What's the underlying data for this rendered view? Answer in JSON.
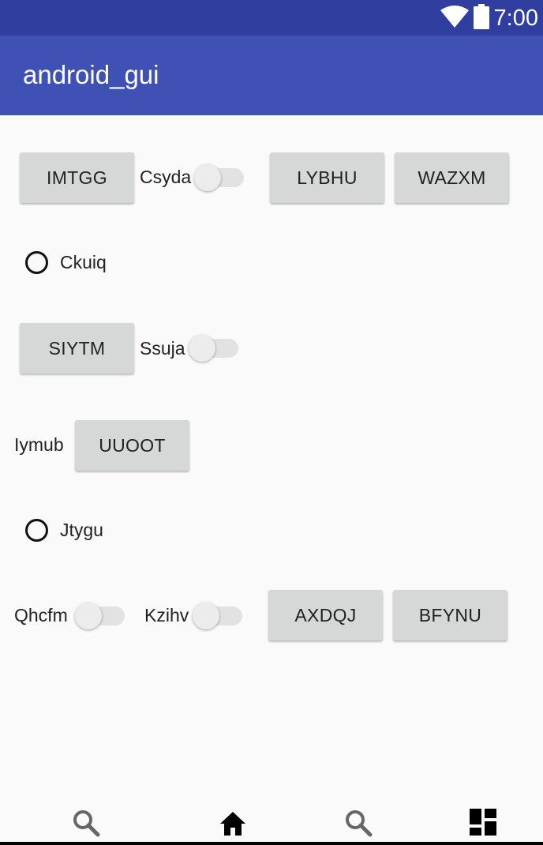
{
  "status_bar": {
    "time": "7:00",
    "icons": [
      "wifi-icon",
      "battery-icon"
    ]
  },
  "app_bar": {
    "title": "android_gui"
  },
  "controls": {
    "imtgg": "IMTGG",
    "csyda": "Csyda",
    "lybhu": "LYBHU",
    "wazxm": "WAZXM",
    "ckuiq": "Ckuiq",
    "siytm": "SIYTM",
    "ssuja": "Ssuja",
    "iymub": "Iymub",
    "uuoot": "UUOOT",
    "jtygu": "Jtygu",
    "qhcfm": "Qhcfm",
    "kzihv": "Kzihv",
    "axdqj": "AXDQJ",
    "bfynu": "BFYNU"
  },
  "switch_states": {
    "csyda": false,
    "ssuja": false,
    "qhcfm": false,
    "kzihv": false
  },
  "radio_states": {
    "ckuiq": false,
    "jtygu": false
  },
  "bottom_nav": [
    "search-icon",
    "home-icon",
    "search-icon",
    "dashboard-icon"
  ],
  "colors": {
    "status_bar": "#303f9f",
    "app_bar": "#3f51b5",
    "background": "#fafafa",
    "button": "#d6d7d7"
  }
}
